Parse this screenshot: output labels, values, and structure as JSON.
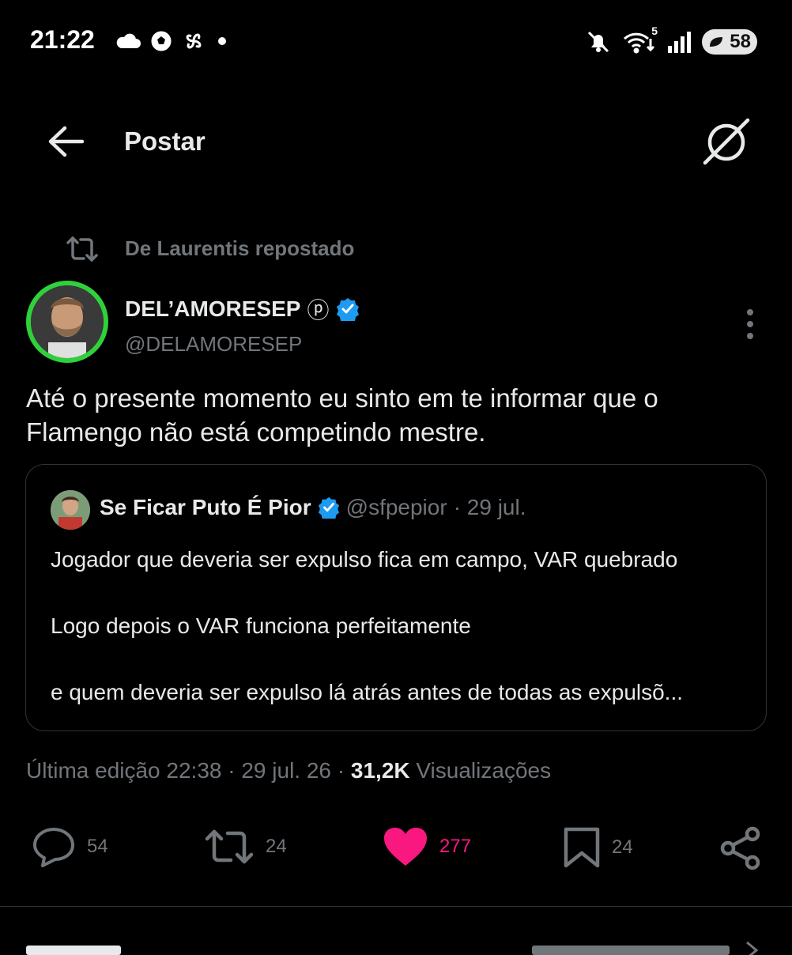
{
  "status_bar": {
    "time": "21:22",
    "left_icons": [
      "cloud-icon",
      "soccer-ball-icon",
      "pinwheel-icon",
      "dot-icon"
    ],
    "right_icons": [
      "mute-icon",
      "wifi-icon",
      "signal-icon"
    ],
    "wifi_badge": "5",
    "battery": "58"
  },
  "header": {
    "title": "Postar",
    "back_icon": "arrow-left-icon",
    "grok_icon": "grok-icon"
  },
  "repost": {
    "text": "De Laurentis repostado"
  },
  "author": {
    "name": "DEL’AMORESEP",
    "badge": "ⓟ",
    "handle": "@DELAMORESEP",
    "verified": true
  },
  "tweet": {
    "line1": "Até o presente momento eu sinto em te informar que o",
    "line2": "Flamengo não está competindo mestre."
  },
  "quote": {
    "name": "Se Ficar Puto É Pior",
    "handle": "@sfpepior",
    "date": "· 29 jul.",
    "line1": "Jogador que deveria ser expulso fica em campo, VAR quebrado",
    "line2": "Logo depois o VAR funciona perfeitamente",
    "line3": "e quem deveria ser expulso lá atrás antes de todas as expulsõ..."
  },
  "meta": {
    "edited": "Última edição 22:38 · 29 jul. 26 ·",
    "views_count": "31,2K",
    "views_label": "Visualizações"
  },
  "actions": {
    "replies": "54",
    "reposts": "24",
    "likes": "277",
    "bookmarks": "24"
  },
  "colors": {
    "background": "#000000",
    "text": "#e7e9ea",
    "muted": "#71767b",
    "like": "#f91880",
    "verified": "#1d9bf0",
    "border": "#2f3336"
  }
}
